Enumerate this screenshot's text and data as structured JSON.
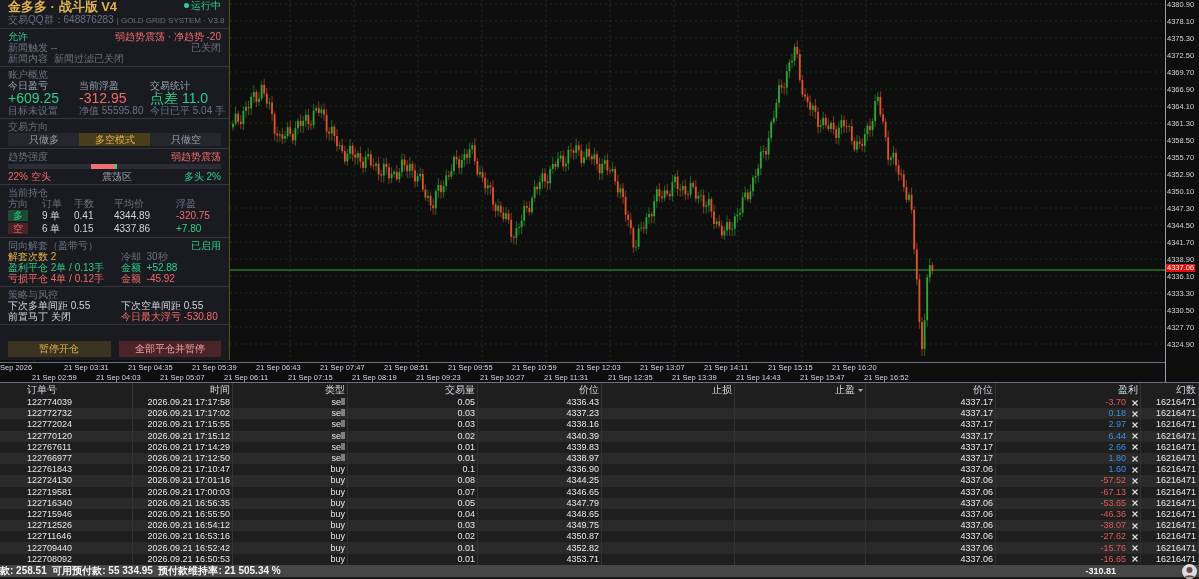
{
  "panel": {
    "title": "金多多 · 战斗版 V4",
    "group_label": "交易QQ群：648876283",
    "system_label": "| GOLD GRID SYSTEM · V3.8",
    "status": "运行中",
    "running": true,
    "signal": {
      "permission": "允许",
      "trend": "弱趋势震荡 · 净趋势 -20",
      "news_label": "新闻触发",
      "news_value": "--",
      "news_state": "已关闭",
      "news_content": "新闻内容  新闻过滤已关闭"
    },
    "account": {
      "title": "账户概览",
      "stats": [
        {
          "label": "今日盈亏",
          "value": "+609.25",
          "note": "目标未设置",
          "color": "#2fcf8a"
        },
        {
          "label": "当前浮盈",
          "value": "-312.95",
          "note": "净值 55595.80",
          "color": "#f26a6a"
        },
        {
          "label": "交易统计",
          "value": "点差 11.0",
          "note": "今日已平 5.04 手",
          "color": "#2fcf8a"
        }
      ]
    },
    "direction": {
      "title": "交易方向",
      "modes": [
        {
          "label": "只做多",
          "selected": false
        },
        {
          "label": "多空模式",
          "selected": true
        },
        {
          "label": "只做空",
          "selected": false
        }
      ]
    },
    "trend": {
      "title": "趋势强度",
      "state": "弱趋势震荡",
      "bear": {
        "label": "22% 空头",
        "level": 0.22
      },
      "center_label": "震荡区",
      "bull": {
        "label": "多头 2%",
        "level": 0.02
      }
    },
    "positions": {
      "title": "当前持仓",
      "columns": [
        "方向",
        "订单",
        "手数",
        "平均价",
        "浮盈"
      ],
      "rows": [
        {
          "kind": "long",
          "side": "多",
          "orders": "9 单",
          "lots": "0.41",
          "avg": "4344.89",
          "pnl": "-320.75",
          "loss": true
        },
        {
          "kind": "short",
          "side": "空",
          "orders": "6 单",
          "lots": "0.15",
          "avg": "4337.86",
          "pnl": "+7.80",
          "loss": false
        }
      ]
    },
    "hedge": {
      "title": "同向解套（盈带亏）",
      "state": "已启用",
      "count_label": "解套次数",
      "count": "2",
      "cooldown": "冷却  30秒",
      "rows": [
        {
          "kind": "profit",
          "label": "盈利平仓",
          "detail": "2单 / 0.13手",
          "amount": "金额  +52.88"
        },
        {
          "kind": "loss",
          "label": "亏损平仓",
          "detail": "4单 / 0.12手",
          "amount": "金额  -45.92"
        }
      ]
    },
    "strategy": {
      "title": "策略与风控",
      "items": [
        {
          "label": "下次多单间距",
          "value": "0.55",
          "alert": false
        },
        {
          "label": "下次空单间距",
          "value": "0.55",
          "alert": false
        },
        {
          "label": "前置马丁",
          "value": "关闭",
          "alert": false
        },
        {
          "label": "今日最大浮亏",
          "value": "-530.80",
          "alert": true
        }
      ]
    },
    "buttons": [
      {
        "kind": "pause",
        "label": "暂停开仓"
      },
      {
        "kind": "close_all",
        "label": "全部平仓并暂停"
      }
    ]
  },
  "chart": {
    "current_price": "4337.06",
    "price_labels": [
      "4380.90",
      "4378.10",
      "4375.30",
      "4372.50",
      "4369.70",
      "4366.90",
      "4364.10",
      "4361.30",
      "4358.50",
      "4355.70",
      "4352.90",
      "4350.10",
      "4347.30",
      "4344.50",
      "4341.70",
      "4338.90",
      "4336.10",
      "4333.30",
      "4330.50",
      "4327.70",
      "4324.90"
    ],
    "time_labels": [
      "Sep 2026",
      "21 Sep 02:59",
      "21 Sep 03:31",
      "21 Sep 04:03",
      "21 Sep 04:35",
      "21 Sep 05:07",
      "21 Sep 05:39",
      "21 Sep 06:11",
      "21 Sep 06:43",
      "21 Sep 07:15",
      "21 Sep 07:47",
      "21 Sep 08:19",
      "21 Sep 08:51",
      "21 Sep 09:23",
      "21 Sep 09:55",
      "21 Sep 10:27",
      "21 Sep 10:59",
      "21 Sep 11:31",
      "21 Sep 12:03",
      "21 Sep 12:35",
      "21 Sep 13:07",
      "21 Sep 13:39",
      "21 Sep 14:11",
      "21 Sep 14:43",
      "21 Sep 15:15",
      "21 Sep 15:47",
      "21 Sep 16:20",
      "21 Sep 16:52"
    ]
  },
  "table": {
    "columns": [
      {
        "label": "订单号"
      },
      {
        "label": "时间"
      },
      {
        "label": "类型"
      },
      {
        "label": "交易量"
      },
      {
        "label": "价位"
      },
      {
        "label": "止损"
      },
      {
        "label": "止盈",
        "sorted": true
      },
      {
        "label": "价位"
      },
      {
        "label": "盈利"
      },
      {
        "label": "幻数"
      }
    ],
    "rows": [
      {
        "order": "122774039",
        "time": "2026.09.21 17:17:58",
        "type": "sell",
        "volume": "0.05",
        "price": "4336.43",
        "current": "4337.17",
        "profit": "-3.70",
        "loss": true,
        "magic": "16216471"
      },
      {
        "order": "122772732",
        "time": "2026.09.21 17:17:02",
        "type": "sell",
        "volume": "0.03",
        "price": "4337.23",
        "current": "4337.17",
        "profit": "0.18",
        "loss": false,
        "magic": "16216471"
      },
      {
        "order": "122772024",
        "time": "2026.09.21 17:15:55",
        "type": "sell",
        "volume": "0.03",
        "price": "4338.16",
        "current": "4337.17",
        "profit": "2.97",
        "loss": false,
        "magic": "16216471"
      },
      {
        "order": "122770120",
        "time": "2026.09.21 17:15:12",
        "type": "sell",
        "volume": "0.02",
        "price": "4340.39",
        "current": "4337.17",
        "profit": "6.44",
        "loss": false,
        "magic": "16216471"
      },
      {
        "order": "122767611",
        "time": "2026.09.21 17:14:29",
        "type": "sell",
        "volume": "0.01",
        "price": "4339.83",
        "current": "4337.17",
        "profit": "2.66",
        "loss": false,
        "magic": "16216471"
      },
      {
        "order": "122766977",
        "time": "2026.09.21 17:12:50",
        "type": "sell",
        "volume": "0.01",
        "price": "4338.97",
        "current": "4337.17",
        "profit": "1.80",
        "loss": false,
        "magic": "16216471"
      },
      {
        "order": "122761843",
        "time": "2026.09.21 17:10:47",
        "type": "buy",
        "volume": "0.1",
        "price": "4336.90",
        "current": "4337.06",
        "profit": "1.60",
        "loss": false,
        "magic": "16216471"
      },
      {
        "order": "122724130",
        "time": "2026.09.21 17:01:16",
        "type": "buy",
        "volume": "0.08",
        "price": "4344.25",
        "current": "4337.06",
        "profit": "-57.52",
        "loss": true,
        "magic": "16216471"
      },
      {
        "order": "122719581",
        "time": "2026.09.21 17:00:03",
        "type": "buy",
        "volume": "0.07",
        "price": "4346.65",
        "current": "4337.06",
        "profit": "-67.13",
        "loss": true,
        "magic": "16216471"
      },
      {
        "order": "122716340",
        "time": "2026.09.21 16:56:35",
        "type": "buy",
        "volume": "0.05",
        "price": "4347.79",
        "current": "4337.06",
        "profit": "-53.65",
        "loss": true,
        "magic": "16216471"
      },
      {
        "order": "122715946",
        "time": "2026.09.21 16:55:50",
        "type": "buy",
        "volume": "0.04",
        "price": "4348.65",
        "current": "4337.06",
        "profit": "-46.36",
        "loss": true,
        "magic": "16216471"
      },
      {
        "order": "122712526",
        "time": "2026.09.21 16:54:12",
        "type": "buy",
        "volume": "0.03",
        "price": "4349.75",
        "current": "4337.06",
        "profit": "-38.07",
        "loss": true,
        "magic": "16216471"
      },
      {
        "order": "122711646",
        "time": "2026.09.21 16:53:16",
        "type": "buy",
        "volume": "0.02",
        "price": "4350.87",
        "current": "4337.06",
        "profit": "-27.62",
        "loss": true,
        "magic": "16216471"
      },
      {
        "order": "122709440",
        "time": "2026.09.21 16:52:42",
        "type": "buy",
        "volume": "0.01",
        "price": "4352.82",
        "current": "4337.06",
        "profit": "-15.76",
        "loss": true,
        "magic": "16216471"
      },
      {
        "order": "122708092",
        "time": "2026.09.21 16:50:53",
        "type": "buy",
        "volume": "0.01",
        "price": "4353.71",
        "current": "4337.06",
        "profit": "-16.65",
        "loss": true,
        "magic": "16216471"
      }
    ],
    "footer": {
      "summary": "款: 258.51  可用预付款: 55 334.95  预付款维持率: 21 505.34 %",
      "total": "-310.81"
    }
  }
}
